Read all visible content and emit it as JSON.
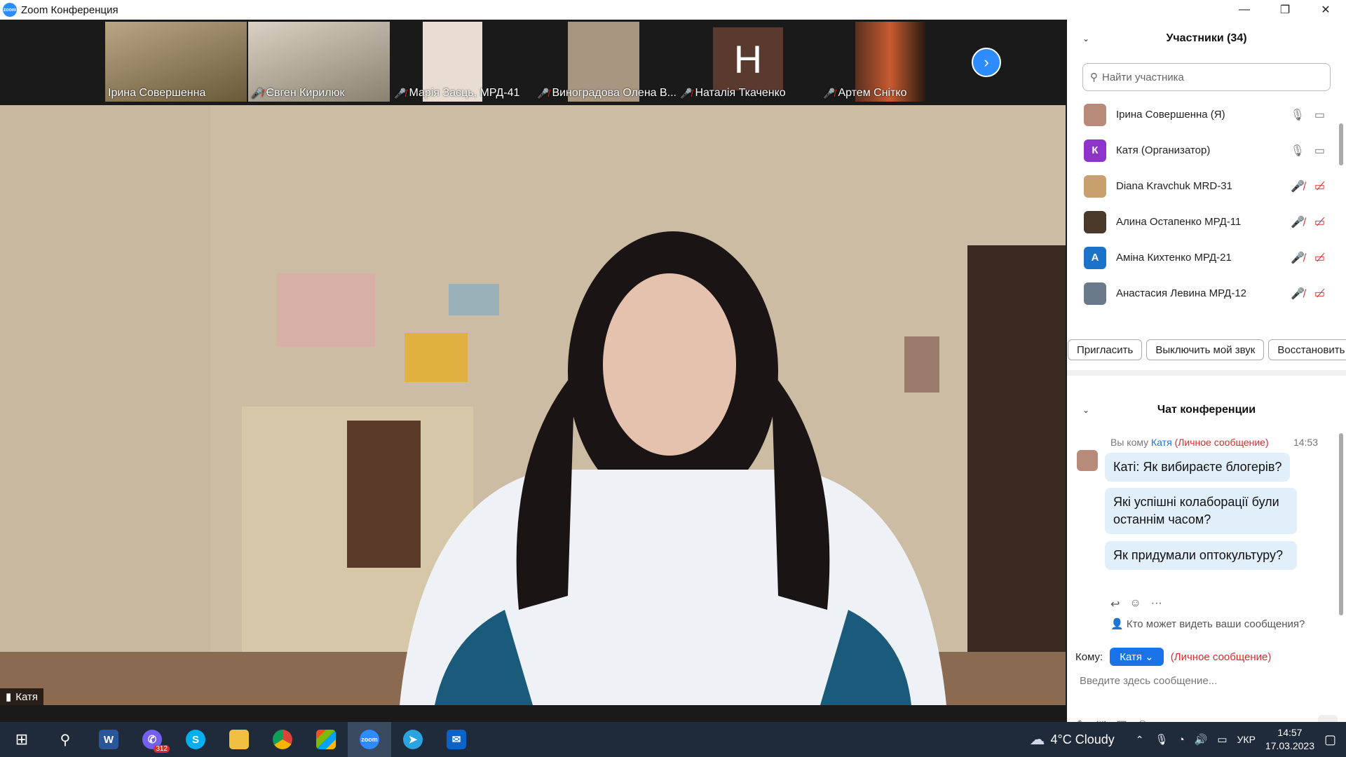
{
  "window": {
    "title": "Zoom Конференция",
    "app_icon_text": "zoom"
  },
  "controls": {
    "minimize": "—",
    "restore": "❐",
    "close": "✕"
  },
  "thumbnails": [
    {
      "name": "Ірина Совершенна",
      "muted": false,
      "bg": "#8a7a5a"
    },
    {
      "name": "Євген Кирилюк",
      "muted": true,
      "bg": "#9a9080"
    },
    {
      "name": "Марія Заєць, МРД-41",
      "muted": true,
      "bg": "#c9b9a4"
    },
    {
      "name": "Виноградова Олена В...",
      "muted": true,
      "bg": "#6a5a4a"
    },
    {
      "name": "Наталія Ткаченко",
      "muted": true,
      "bg": "#1a1a1a",
      "letter": "Н"
    },
    {
      "name": "Артем Снітко",
      "muted": true,
      "bg": "#3a2a20"
    }
  ],
  "next_icon": "›",
  "main_video": {
    "speaker": "Катя",
    "signal_icon": "▮"
  },
  "participants": {
    "title": "Участники (34)",
    "collapse_icon": "⌄",
    "search_placeholder": "Найти участника",
    "search_icon": "⚲",
    "list": [
      {
        "name": "Ірина Совершенна (Я)",
        "avatar": "",
        "avatar_color": "#b88a7a",
        "muted": false,
        "video_off": false
      },
      {
        "name": "Катя (Организатор)",
        "avatar": "К",
        "avatar_color": "#8e33c9",
        "muted": false,
        "video_off": false
      },
      {
        "name": "Diana Kravchuk MRD-31",
        "avatar": "",
        "avatar_color": "#c8a070",
        "muted": true,
        "video_off": true
      },
      {
        "name": "Алина Остапенко МРД-11",
        "avatar": "",
        "avatar_color": "#4a3a2a",
        "muted": true,
        "video_off": true
      },
      {
        "name": "Аміна Кихтенко МРД-21",
        "avatar": "А",
        "avatar_color": "#1a73c8",
        "muted": true,
        "video_off": true
      },
      {
        "name": "Анастасия Левина МРД-12",
        "avatar": "",
        "avatar_color": "#6a7a8a",
        "muted": true,
        "video_off": true
      }
    ],
    "buttons": [
      "Пригласить",
      "Выключить мой звук",
      "Восстановить"
    ]
  },
  "chat": {
    "title": "Чат конференции",
    "meta_you": "Вы кому",
    "meta_to": "Катя",
    "meta_private": "(Личное сообщение)",
    "time": "14:53",
    "messages": [
      "Каті: Як вибираєте блогерів?",
      "Які успішні колаборації були останнім часом?",
      "Як придумали оптокультуру?"
    ],
    "who_can_see": "Кто может видеть ваши сообщения?",
    "to_label": "Кому:",
    "to_value": "Катя",
    "to_private": "(Личное сообщение)",
    "input_placeholder": "Введите здесь сообщение..."
  },
  "taskbar": {
    "viber_badge": "312",
    "weather": "4°C  Cloudy",
    "lang": "УКР",
    "time": "14:57",
    "date": "17.03.2023"
  }
}
